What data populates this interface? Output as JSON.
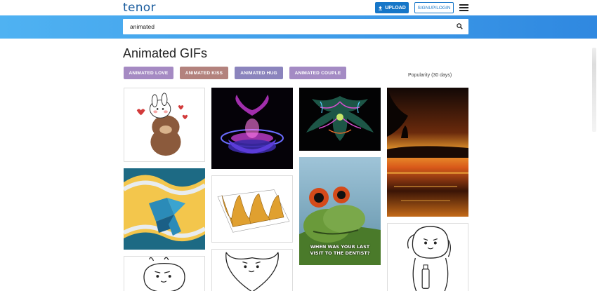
{
  "header": {
    "logo": "tenor",
    "upload_label": "UPLOAD",
    "login_label": "SIGNUP/LOGIN"
  },
  "search": {
    "query": "animated"
  },
  "main": {
    "title": "Animated GIFs",
    "chips": [
      {
        "label": "ANIMATED LOVE",
        "color": "#a58ac3"
      },
      {
        "label": "ANIMATED KISS",
        "color": "#b3827d"
      },
      {
        "label": "ANIMATED HUG",
        "color": "#8b84bd"
      },
      {
        "label": "ANIMATED COUPLE",
        "color": "#a48bc4"
      }
    ],
    "sort_label": "Popularity (30 days)"
  },
  "gifs": [
    {
      "subject": "bears-hug-sticker"
    },
    {
      "subject": "purple-fractal"
    },
    {
      "subject": "neon-fractal"
    },
    {
      "subject": "sunset-reflection"
    },
    {
      "subject": "blue-cube-shark"
    },
    {
      "subject": "3d-surface-plot"
    },
    {
      "subject": "frog-dentist",
      "caption_line1": "WHEN WAS YOUR LAST",
      "caption_line2": "VISIT TO THE DENTIST?"
    },
    {
      "subject": "line-drawing-bunny"
    },
    {
      "subject": "line-drawing-heart"
    },
    {
      "subject": "line-drawing-astronaut"
    }
  ]
}
